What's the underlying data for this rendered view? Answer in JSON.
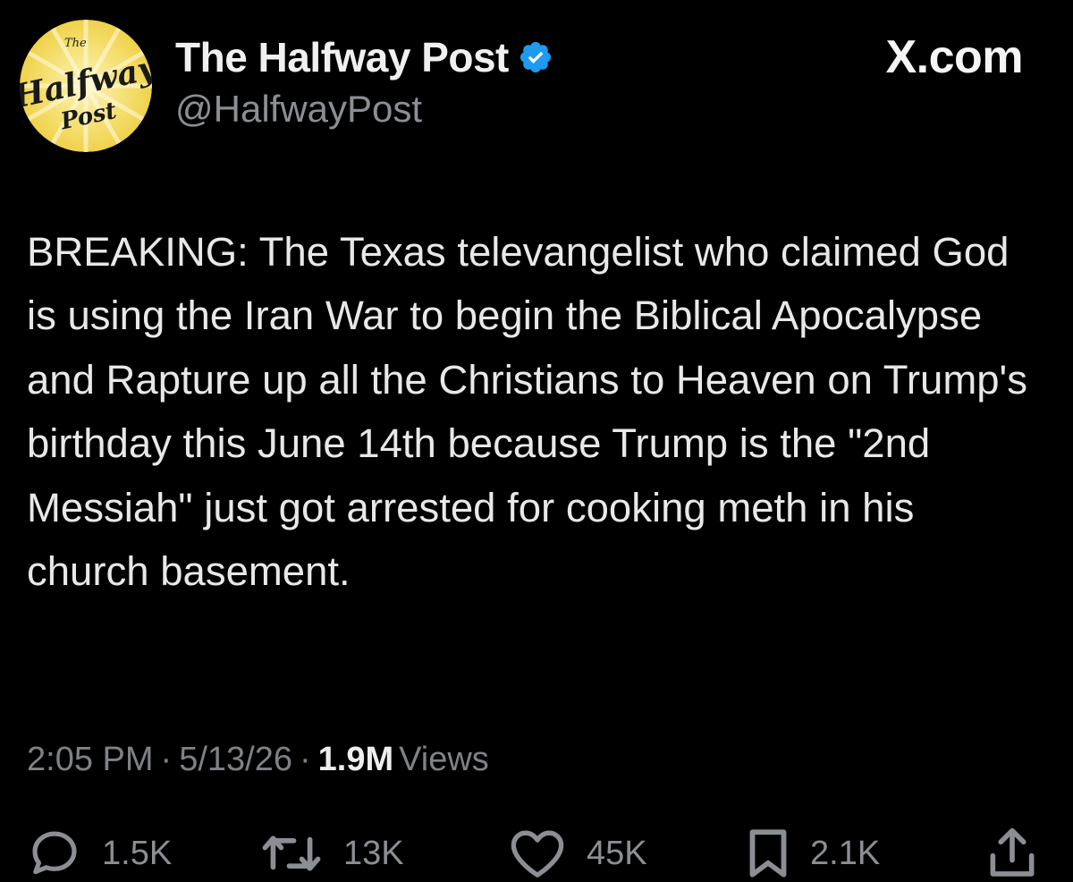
{
  "header": {
    "display_name": "The Halfway Post",
    "handle": "@HalfwayPost",
    "brand": "X.com",
    "avatar_logo": {
      "small": "The",
      "line1": "Halfway",
      "line2": "Post"
    },
    "verified_icon": "verified-badge-icon"
  },
  "tweet": {
    "text": "BREAKING: The Texas televangelist who claimed God is using the Iran War to begin the Biblical Apocalypse and Rapture up all the Christians to Heaven on Trump's birthday this June 14th because Trump is the \"2nd Messiah\" just got arrested for cooking meth in his church basement."
  },
  "meta": {
    "time": "2:05 PM",
    "separator": "·",
    "date": "5/13/26",
    "views_count": "1.9M",
    "views_label": "Views"
  },
  "actions": {
    "reply": {
      "icon": "reply-icon",
      "count": "1.5K"
    },
    "repost": {
      "icon": "repost-icon",
      "count": "13K"
    },
    "like": {
      "icon": "heart-icon",
      "count": "45K"
    },
    "bookmark": {
      "icon": "bookmark-icon",
      "count": "2.1K"
    },
    "share": {
      "icon": "share-icon"
    }
  },
  "colors": {
    "background": "#000000",
    "text": "#e7e9ea",
    "muted": "#8b8f94",
    "verified": "#1d9bf0",
    "avatar_yellow": "#f7e37a"
  }
}
